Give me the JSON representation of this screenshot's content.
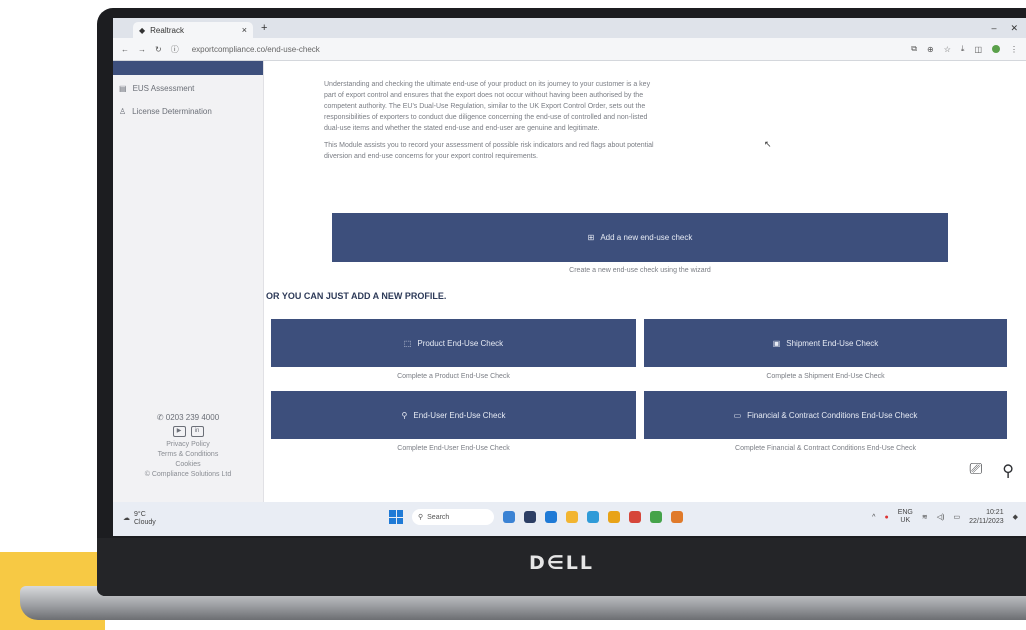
{
  "device": {
    "brand": "D∈LL"
  },
  "browser": {
    "tab_title": "Realtrack",
    "url": "exportcompliance.co/end-use-check",
    "window_controls": [
      "–",
      "✕"
    ]
  },
  "sidebar": {
    "items": [
      {
        "label": "EUS Assessment",
        "icon": "chart-icon"
      },
      {
        "label": "License Determination",
        "icon": "person-icon"
      }
    ],
    "contact": {
      "phone": "0203 239 4000",
      "links": [
        "Privacy Policy",
        "Terms & Conditions",
        "Cookies"
      ],
      "copyright": "© Compliance Solutions Ltd"
    }
  },
  "main": {
    "intro_paragraphs": [
      "Understanding and checking the ultimate end-use of your product on its journey to your customer is a key part of export control and ensures that the export does not occur without having been authorised by the competent authority. The EU's Dual-Use Regulation, similar to the UK Export Control Order, sets out the responsibilities of exporters to conduct due diligence concerning the end-use of controlled and non-listed dual-use items and whether the stated end-use and end-user are genuine and legitimate.",
      "This Module assists you to record your assessment of possible risk indicators and red flags about potential diversion and end-use concerns for your export control requirements."
    ],
    "primary_button": {
      "label": "Add a new end-use check",
      "icon": "plus-icon"
    },
    "primary_caption": "Create a new end-use check using the wizard",
    "or_heading": "OR YOU CAN JUST ADD A NEW PROFILE.",
    "profile_buttons": [
      {
        "label": "Product End-Use Check",
        "icon": "box-icon",
        "caption": "Complete a Product End-Use Check"
      },
      {
        "label": "Shipment End-Use Check",
        "icon": "shipment-icon",
        "caption": "Complete a Shipment End-Use Check"
      },
      {
        "label": "End-User End-Use Check",
        "icon": "user-icon",
        "caption": "Complete End-User End-Use Check"
      },
      {
        "label": "Financial & Contract Conditions End-Use Check",
        "icon": "contract-icon",
        "caption": "Complete Financial & Contract Conditions End-Use Check"
      }
    ]
  },
  "taskbar": {
    "weather_temp": "9°C",
    "weather_desc": "Cloudy",
    "search_placeholder": "Search",
    "tray_lang": "ENG",
    "tray_region": "UK",
    "time": "10:21",
    "date": "22/11/2023"
  },
  "colors": {
    "accent": "#3d4f7c",
    "frame_yellow": "#f7c944",
    "bezel": "#1c1d20"
  }
}
